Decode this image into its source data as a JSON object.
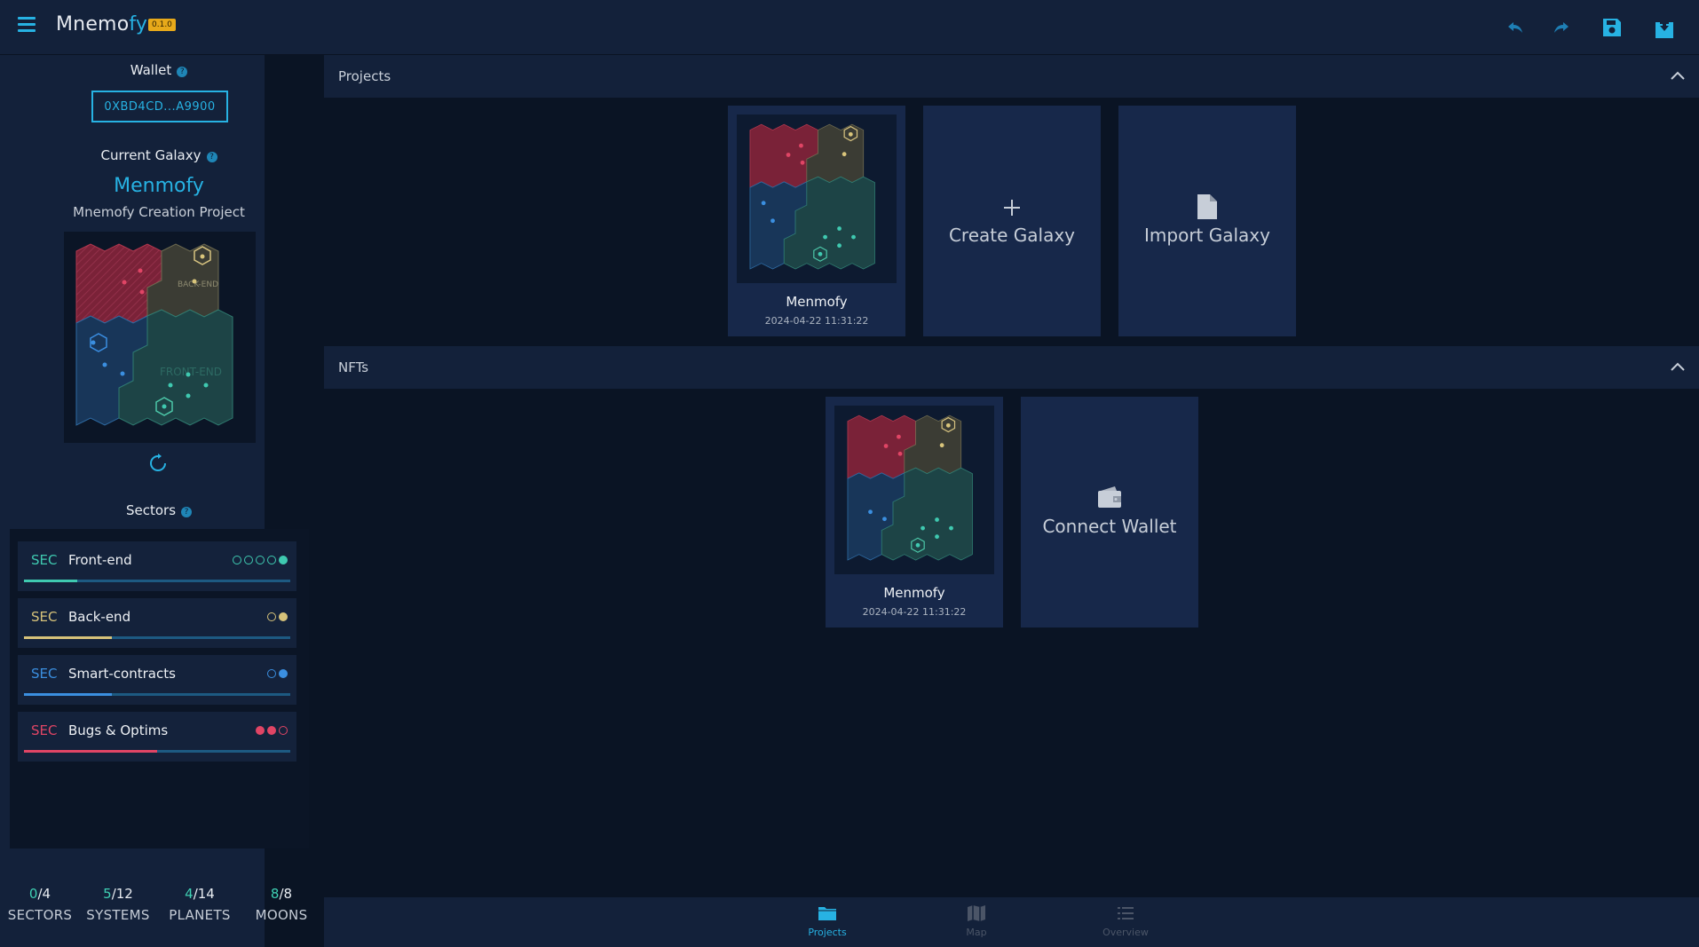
{
  "header": {
    "app_name_main": "Mnemo",
    "app_name_accent": "fy",
    "version": "0.1.0",
    "icons": [
      "menu-icon",
      "undo-icon",
      "redo-icon",
      "save-icon",
      "download-icon"
    ]
  },
  "sidebar": {
    "wallet_label": "Wallet",
    "wallet_address": "0XBD4CD...A9900",
    "current_galaxy_label": "Current Galaxy",
    "galaxy_name": "Menmofy",
    "galaxy_subtitle": "Mnemofy Creation Project",
    "map_labels": {
      "backend": "BACK-END",
      "frontend": "FRONT-END"
    },
    "sectors_label": "Sectors",
    "sectors": [
      {
        "tag": "SEC",
        "name": "Front-end",
        "color": "#3fc9b0",
        "dots": [
          false,
          false,
          false,
          false,
          true
        ],
        "progress": 0.2
      },
      {
        "tag": "SEC",
        "name": "Back-end",
        "color": "#d6c27a",
        "dots": [
          false,
          true
        ],
        "progress": 0.33
      },
      {
        "tag": "SEC",
        "name": "Smart-contracts",
        "color": "#3b8fe0",
        "dots": [
          false,
          true
        ],
        "progress": 0.33
      },
      {
        "tag": "SEC",
        "name": "Bugs & Optims",
        "color": "#e04565",
        "dots": [
          true,
          true,
          false
        ],
        "progress": 0.5
      }
    ],
    "stats": [
      {
        "done": "0",
        "total": "/4",
        "label": "SECTORS"
      },
      {
        "done": "5",
        "total": "/12",
        "label": "SYSTEMS"
      },
      {
        "done": "4",
        "total": "/14",
        "label": "PLANETS"
      },
      {
        "done": "8",
        "total": "/8",
        "label": "MOONS"
      }
    ]
  },
  "projects": {
    "title": "Projects",
    "card": {
      "name": "Menmofy",
      "date": "2024-04-22 11:31:22"
    },
    "create_label": "Create Galaxy",
    "import_label": "Import Galaxy"
  },
  "nfts": {
    "title": "NFTs",
    "card": {
      "name": "Menmofy",
      "date": "2024-04-22 11:31:22"
    },
    "connect_label": "Connect Wallet"
  },
  "bottom_nav": {
    "items": [
      {
        "label": "Projects",
        "icon": "folder-icon",
        "active": true
      },
      {
        "label": "Map",
        "icon": "map-icon",
        "active": false
      },
      {
        "label": "Overview",
        "icon": "list-icon",
        "active": false
      }
    ]
  },
  "colors": {
    "accent": "#27b2e3",
    "bg": "#0a1424",
    "panel": "#13213a",
    "card": "#17284a"
  }
}
